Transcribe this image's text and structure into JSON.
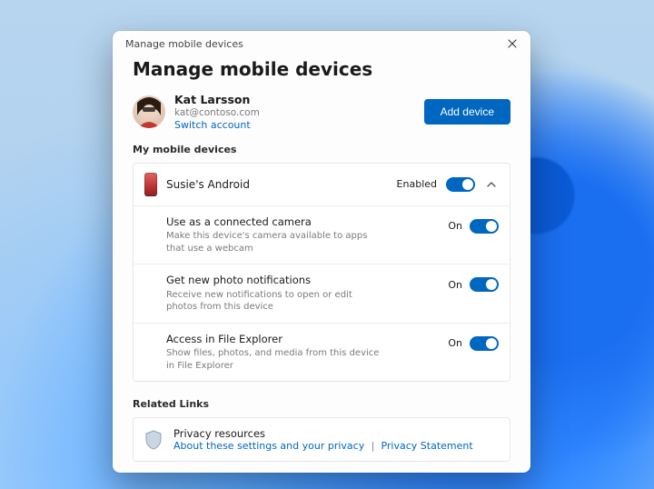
{
  "window": {
    "title": "Manage mobile devices"
  },
  "page": {
    "heading": "Manage mobile devices"
  },
  "account": {
    "name": "Kat Larsson",
    "email": "kat@contoso.com",
    "switch_label": "Switch account",
    "add_device_label": "Add device"
  },
  "devices": {
    "section_label": "My mobile devices",
    "items": [
      {
        "name": "Susie's Android",
        "status_label": "Enabled",
        "expanded": true,
        "options": [
          {
            "title": "Use as a connected camera",
            "description": "Make this device's camera available to apps that use a webcam",
            "state_label": "On"
          },
          {
            "title": "Get new photo notifications",
            "description": "Receive new notifications to open or edit photos from this device",
            "state_label": "On"
          },
          {
            "title": "Access in File Explorer",
            "description": "Show files, photos, and media from this device in File Explorer",
            "state_label": "On"
          }
        ]
      }
    ]
  },
  "related": {
    "section_label": "Related Links",
    "title": "Privacy resources",
    "link1": "About these settings and your privacy",
    "separator": "|",
    "link2": "Privacy Statement"
  }
}
